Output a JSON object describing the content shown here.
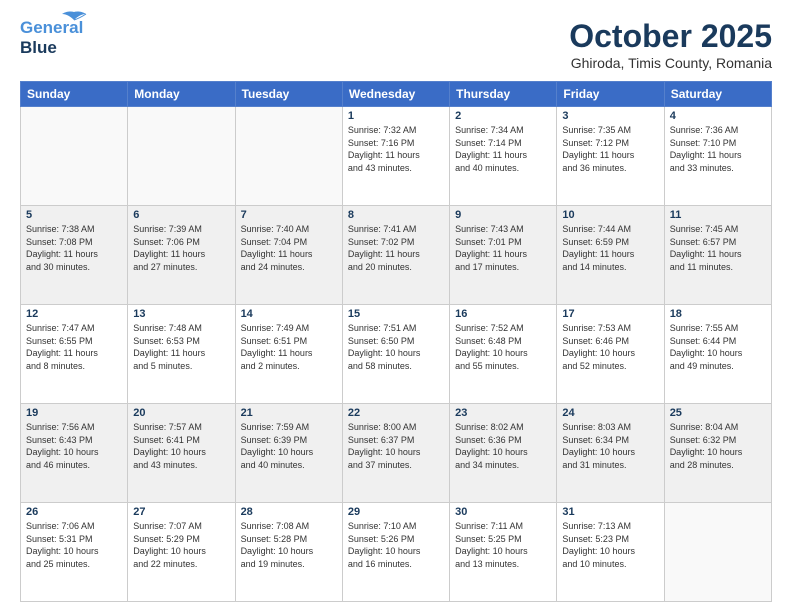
{
  "header": {
    "logo_line1": "General",
    "logo_line2": "Blue",
    "month": "October 2025",
    "location": "Ghiroda, Timis County, Romania"
  },
  "days_of_week": [
    "Sunday",
    "Monday",
    "Tuesday",
    "Wednesday",
    "Thursday",
    "Friday",
    "Saturday"
  ],
  "weeks": [
    [
      {
        "day": "",
        "info": ""
      },
      {
        "day": "",
        "info": ""
      },
      {
        "day": "",
        "info": ""
      },
      {
        "day": "1",
        "info": "Sunrise: 7:32 AM\nSunset: 7:16 PM\nDaylight: 11 hours\nand 43 minutes."
      },
      {
        "day": "2",
        "info": "Sunrise: 7:34 AM\nSunset: 7:14 PM\nDaylight: 11 hours\nand 40 minutes."
      },
      {
        "day": "3",
        "info": "Sunrise: 7:35 AM\nSunset: 7:12 PM\nDaylight: 11 hours\nand 36 minutes."
      },
      {
        "day": "4",
        "info": "Sunrise: 7:36 AM\nSunset: 7:10 PM\nDaylight: 11 hours\nand 33 minutes."
      }
    ],
    [
      {
        "day": "5",
        "info": "Sunrise: 7:38 AM\nSunset: 7:08 PM\nDaylight: 11 hours\nand 30 minutes."
      },
      {
        "day": "6",
        "info": "Sunrise: 7:39 AM\nSunset: 7:06 PM\nDaylight: 11 hours\nand 27 minutes."
      },
      {
        "day": "7",
        "info": "Sunrise: 7:40 AM\nSunset: 7:04 PM\nDaylight: 11 hours\nand 24 minutes."
      },
      {
        "day": "8",
        "info": "Sunrise: 7:41 AM\nSunset: 7:02 PM\nDaylight: 11 hours\nand 20 minutes."
      },
      {
        "day": "9",
        "info": "Sunrise: 7:43 AM\nSunset: 7:01 PM\nDaylight: 11 hours\nand 17 minutes."
      },
      {
        "day": "10",
        "info": "Sunrise: 7:44 AM\nSunset: 6:59 PM\nDaylight: 11 hours\nand 14 minutes."
      },
      {
        "day": "11",
        "info": "Sunrise: 7:45 AM\nSunset: 6:57 PM\nDaylight: 11 hours\nand 11 minutes."
      }
    ],
    [
      {
        "day": "12",
        "info": "Sunrise: 7:47 AM\nSunset: 6:55 PM\nDaylight: 11 hours\nand 8 minutes."
      },
      {
        "day": "13",
        "info": "Sunrise: 7:48 AM\nSunset: 6:53 PM\nDaylight: 11 hours\nand 5 minutes."
      },
      {
        "day": "14",
        "info": "Sunrise: 7:49 AM\nSunset: 6:51 PM\nDaylight: 11 hours\nand 2 minutes."
      },
      {
        "day": "15",
        "info": "Sunrise: 7:51 AM\nSunset: 6:50 PM\nDaylight: 10 hours\nand 58 minutes."
      },
      {
        "day": "16",
        "info": "Sunrise: 7:52 AM\nSunset: 6:48 PM\nDaylight: 10 hours\nand 55 minutes."
      },
      {
        "day": "17",
        "info": "Sunrise: 7:53 AM\nSunset: 6:46 PM\nDaylight: 10 hours\nand 52 minutes."
      },
      {
        "day": "18",
        "info": "Sunrise: 7:55 AM\nSunset: 6:44 PM\nDaylight: 10 hours\nand 49 minutes."
      }
    ],
    [
      {
        "day": "19",
        "info": "Sunrise: 7:56 AM\nSunset: 6:43 PM\nDaylight: 10 hours\nand 46 minutes."
      },
      {
        "day": "20",
        "info": "Sunrise: 7:57 AM\nSunset: 6:41 PM\nDaylight: 10 hours\nand 43 minutes."
      },
      {
        "day": "21",
        "info": "Sunrise: 7:59 AM\nSunset: 6:39 PM\nDaylight: 10 hours\nand 40 minutes."
      },
      {
        "day": "22",
        "info": "Sunrise: 8:00 AM\nSunset: 6:37 PM\nDaylight: 10 hours\nand 37 minutes."
      },
      {
        "day": "23",
        "info": "Sunrise: 8:02 AM\nSunset: 6:36 PM\nDaylight: 10 hours\nand 34 minutes."
      },
      {
        "day": "24",
        "info": "Sunrise: 8:03 AM\nSunset: 6:34 PM\nDaylight: 10 hours\nand 31 minutes."
      },
      {
        "day": "25",
        "info": "Sunrise: 8:04 AM\nSunset: 6:32 PM\nDaylight: 10 hours\nand 28 minutes."
      }
    ],
    [
      {
        "day": "26",
        "info": "Sunrise: 7:06 AM\nSunset: 5:31 PM\nDaylight: 10 hours\nand 25 minutes."
      },
      {
        "day": "27",
        "info": "Sunrise: 7:07 AM\nSunset: 5:29 PM\nDaylight: 10 hours\nand 22 minutes."
      },
      {
        "day": "28",
        "info": "Sunrise: 7:08 AM\nSunset: 5:28 PM\nDaylight: 10 hours\nand 19 minutes."
      },
      {
        "day": "29",
        "info": "Sunrise: 7:10 AM\nSunset: 5:26 PM\nDaylight: 10 hours\nand 16 minutes."
      },
      {
        "day": "30",
        "info": "Sunrise: 7:11 AM\nSunset: 5:25 PM\nDaylight: 10 hours\nand 13 minutes."
      },
      {
        "day": "31",
        "info": "Sunrise: 7:13 AM\nSunset: 5:23 PM\nDaylight: 10 hours\nand 10 minutes."
      },
      {
        "day": "",
        "info": ""
      }
    ]
  ]
}
